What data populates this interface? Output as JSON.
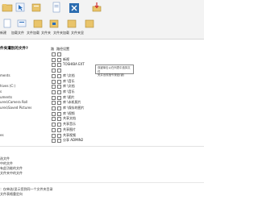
{
  "toolbar": {
    "buttons": [
      {
        "label": "",
        "icon": "folder-open-icon"
      },
      {
        "label": "",
        "icon": "pointer-icon"
      },
      {
        "label": "",
        "icon": "folder-icon"
      },
      {
        "label": "",
        "icon": "file-icon"
      },
      {
        "label": "",
        "icon": "close-icon"
      },
      {
        "label": "",
        "icon": "download-icon"
      }
    ],
    "row2": [
      {
        "label": "新建",
        "icon": "new-icon"
      },
      {
        "label": "加载文件",
        "icon": "load-icon"
      },
      {
        "label": "文件夹",
        "icon": "folder-icon"
      },
      {
        "label": "文件夹",
        "icon": "folder-icon"
      },
      {
        "label": "文件夹",
        "icon": "folder-icon"
      },
      {
        "label": "文件夹",
        "icon": "folder-icon"
      },
      {
        "label": "文件夹",
        "icon": "folder-icon"
      }
    ],
    "row2_text": [
      "新建",
      "加载文件",
      "文件加载",
      "文件夹",
      "文件夹加载",
      "文件夹显"
    ]
  },
  "question": "件夹遭别的文件?",
  "columns": {
    "col1": "路",
    "col2": "路径",
    "col3": "设置"
  },
  "rows": [
    {
      "label": "",
      "name": ""
    },
    {
      "label": "",
      "name": "新视"
    },
    {
      "label": "",
      "name": "TOSHIBA EXT"
    },
    {
      "label": "",
      "name": ""
    },
    {
      "label": "ments",
      "name": "库 \\文档"
    },
    {
      "label": "",
      "name": "库 \\音乐"
    },
    {
      "label": "hives (C:)",
      "name": "库 \\文档"
    },
    {
      "label": "s",
      "name": "库 \\音乐"
    },
    {
      "label": "uments",
      "name": "库 \\图片"
    },
    {
      "label": "ures\\Camera Roll",
      "name": "库 \\本机照片"
    },
    {
      "label": "ures\\Saved Pictures",
      "name": "库 \\保存的图片"
    },
    {
      "label": "",
      "name": "库 \\视频"
    },
    {
      "label": "",
      "name": "共享文档"
    },
    {
      "label": "",
      "name": "共享音乐"
    },
    {
      "label": "",
      "name": "共享图片"
    },
    {
      "label": "es",
      "name": "共享视频"
    },
    {
      "label": "",
      "name": "分享 ADMIN2"
    }
  ],
  "tooltip": {
    "line1": "双键单击以在列表中选择文件",
    "line2": "夹并出现指令按钮(键)"
  },
  "lower_options": [
    "选文件",
    "中的文件",
    "有此功能的文件",
    "文件夹中的文件"
  ],
  "bottom_options": [
    "：仅单选(显示您到同一个文件夹目录",
    "文件表格重定向"
  ],
  "colors": {
    "toolbar_bg": "#f3f3f3",
    "accent_blue": "#2a6ebb",
    "close_red": "#d03030"
  }
}
